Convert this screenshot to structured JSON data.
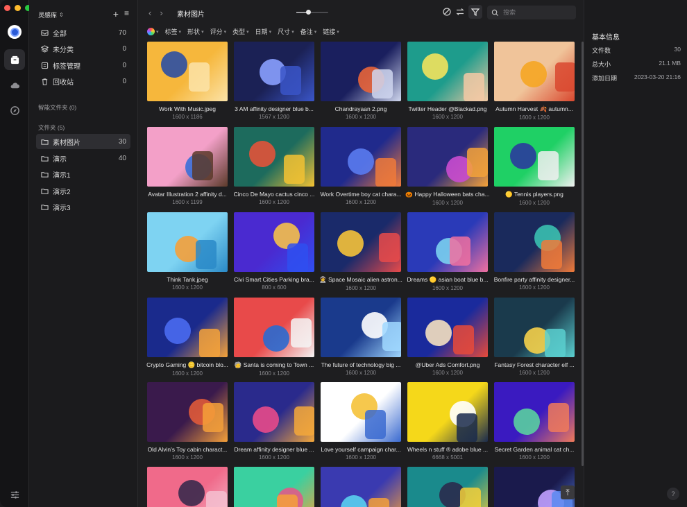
{
  "colors": {
    "accent": "#2f6bff",
    "window_bg": "#1e1e20"
  },
  "library": {
    "name": "灵感库",
    "add_icon": "plus-icon",
    "menu_icon": "menu-icon"
  },
  "sidebar": {
    "items": [
      {
        "label": "全部",
        "count": "70",
        "icon": "inbox-icon"
      },
      {
        "label": "未分类",
        "count": "0",
        "icon": "layers-icon"
      },
      {
        "label": "标签管理",
        "count": "0",
        "icon": "tag-icon"
      },
      {
        "label": "回收站",
        "count": "0",
        "icon": "trash-icon"
      }
    ],
    "smart_folders_label": "智能文件夹 (0)",
    "folders_label": "文件夹 (5)",
    "folders": [
      {
        "label": "素材图片",
        "count": "30"
      },
      {
        "label": "演示",
        "count": "40"
      },
      {
        "label": "演示1",
        "count": ""
      },
      {
        "label": "演示2",
        "count": ""
      },
      {
        "label": "演示3",
        "count": ""
      }
    ]
  },
  "toolbar": {
    "folder_title": "素材图片",
    "search_placeholder": "搜索",
    "zoom": 0.4
  },
  "filters": [
    "标签",
    "形状",
    "评分",
    "类型",
    "日期",
    "尺寸",
    "备注",
    "链接"
  ],
  "items": [
    {
      "name": "Work With Music.jpeg",
      "size": "1600 x 1186",
      "colors": [
        "#f6b73c",
        "#fbe3a8",
        "#2c4fa3"
      ]
    },
    {
      "name": "3 AM affinity designer blue b...",
      "size": "1567 x 1200",
      "colors": [
        "#1b2155",
        "#3a55c8",
        "#8aa0ff"
      ]
    },
    {
      "name": "Chandrayaan 2.png",
      "size": "1600 x 1200",
      "colors": [
        "#1a1f5e",
        "#cfd6ee",
        "#e8643a"
      ]
    },
    {
      "name": "Twitter Header @Blackad.png",
      "size": "1600 x 1200",
      "colors": [
        "#1e9c8c",
        "#f4c9a4",
        "#f2e35c"
      ]
    },
    {
      "name": "Autumn Harvest 🍂 autumn...",
      "size": "1600 x 1200",
      "colors": [
        "#f0c49a",
        "#d9482f",
        "#f5a623"
      ]
    },
    {
      "name": "Avatar Illustration 2 affinity d...",
      "size": "1600 x 1199",
      "colors": [
        "#f3a0c8",
        "#5b3a2a",
        "#3a6fd8"
      ]
    },
    {
      "name": "Cinco De Mayo cactus cinco ...",
      "size": "1600 x 1200",
      "colors": [
        "#1d6b5d",
        "#f3c233",
        "#e2533a"
      ]
    },
    {
      "name": "Work Overtime boy cat chara...",
      "size": "1600 x 1200",
      "colors": [
        "#202a8c",
        "#f07a3a",
        "#5a7bf0"
      ]
    },
    {
      "name": "🎃 Happy Halloween bats cha...",
      "size": "1600 x 1200",
      "colors": [
        "#2a2a7c",
        "#f5a23a",
        "#c94bd0"
      ]
    },
    {
      "name": "🟡 Tennis players.png",
      "size": "1600 x 1200",
      "colors": [
        "#1fd065",
        "#f0f0f0",
        "#2a3a9c"
      ]
    },
    {
      "name": "Think Tank.jpeg",
      "size": "1600 x 1200",
      "colors": [
        "#7ed3f2",
        "#2a8ac8",
        "#f5a03a"
      ]
    },
    {
      "name": "Civi Smart Cities Parking bra...",
      "size": "800 x 600",
      "colors": [
        "#4a2ad0",
        "#2f4ff0",
        "#f5c04a"
      ]
    },
    {
      "name": "🧑‍🚀 Space Mosaic alien astron...",
      "size": "1600 x 1200",
      "colors": [
        "#1a2a6a",
        "#e84a4a",
        "#f5c23a"
      ]
    },
    {
      "name": "Dreams 🟡 asian boat blue b...",
      "size": "1600 x 1200",
      "colors": [
        "#2a3ab8",
        "#f070a0",
        "#7ad0f0"
      ]
    },
    {
      "name": "Bonfire party affinity designer...",
      "size": "1600 x 1200",
      "colors": [
        "#1a2a5c",
        "#f07a3a",
        "#3ac0b0"
      ]
    },
    {
      "name": "Crypto Gaming 🪙 bitcoin blo...",
      "size": "1600 x 1200",
      "colors": [
        "#1a2a8c",
        "#f5a23a",
        "#4a6af0"
      ]
    },
    {
      "name": "🧓 Santa is coming to Town ...",
      "size": "1600 x 1200",
      "colors": [
        "#e84a4a",
        "#f5f5f5",
        "#2a6ad0"
      ]
    },
    {
      "name": "The future of technology big ...",
      "size": "1600 x 1200",
      "colors": [
        "#1a3a8c",
        "#a0d8ff",
        "#ffffff"
      ]
    },
    {
      "name": "@Uber Ads Comfort.png",
      "size": "1600 x 1200",
      "colors": [
        "#1a2a9c",
        "#e84a3a",
        "#f5e0c0"
      ]
    },
    {
      "name": "Fantasy Forest character elf ...",
      "size": "1600 x 1200",
      "colors": [
        "#1a3a4c",
        "#5ad0d0",
        "#f5d04a"
      ]
    },
    {
      "name": "Old Alvin's Toy cabin charact...",
      "size": "1600 x 1200",
      "colors": [
        "#3a1a4c",
        "#f5a03a",
        "#e05a3a"
      ]
    },
    {
      "name": "Dream affinity designer blue ...",
      "size": "1600 x 1200",
      "colors": [
        "#2a2a8c",
        "#f5a83a",
        "#e84a8a"
      ]
    },
    {
      "name": "Love yourself campaign char...",
      "size": "1600 x 1200",
      "colors": [
        "#ffffff",
        "#3a6ad0",
        "#f5c23a"
      ]
    },
    {
      "name": "Wheels n stuff ® adobe blue ...",
      "size": "6668 x 5001",
      "colors": [
        "#f5d81a",
        "#1a2a4c",
        "#ffffff"
      ]
    },
    {
      "name": "Secret Garden animal cat ch...",
      "size": "1600 x 1200",
      "colors": [
        "#3a1ac0",
        "#f07a5a",
        "#5ad0a0"
      ]
    },
    {
      "name": "",
      "size": "",
      "colors": [
        "#f06a8a",
        "#f5c0d0",
        "#3a2a4c"
      ]
    },
    {
      "name": "",
      "size": "",
      "colors": [
        "#3ad0a0",
        "#f5a03a",
        "#e05a8a"
      ]
    },
    {
      "name": "",
      "size": "",
      "colors": [
        "#3a3ab0",
        "#f5a03a",
        "#5ad0f0"
      ]
    },
    {
      "name": "",
      "size": "",
      "colors": [
        "#1a8a8c",
        "#f5d03a",
        "#2a2a4c"
      ]
    },
    {
      "name": "",
      "size": "",
      "colors": [
        "#1a1a4c",
        "#5a8af0",
        "#c0a0ff"
      ]
    }
  ],
  "inspector": {
    "title": "基本信息",
    "rows": [
      {
        "key": "文件数",
        "value": "30"
      },
      {
        "key": "总大小",
        "value": "21.1 MB"
      },
      {
        "key": "添加日期",
        "value": "2023-03-20 21:16"
      }
    ]
  }
}
